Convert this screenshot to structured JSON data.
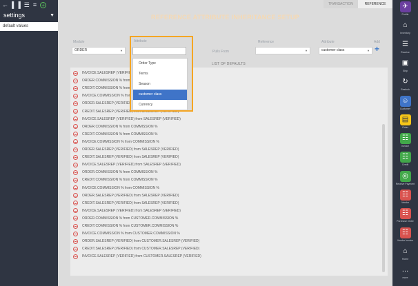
{
  "left_sidebar": {
    "header": "settings",
    "items": [
      "default values"
    ]
  },
  "tabs": [
    {
      "label": "TRANSACTION",
      "active": false
    },
    {
      "label": "REFERENCE",
      "active": true
    }
  ],
  "page_title": "REFERENCE ATTRIBUTE INHERITANCE SETUP",
  "form": {
    "module_label": "Module",
    "module_value": "ORDER",
    "attribute_label": "Attribute",
    "pulls_from_label": "Pulls From",
    "reference_label": "Reference",
    "attribute2_label": "Attribute",
    "attribute2_value": "customer class",
    "add_label": "Add"
  },
  "attribute_options": [
    {
      "label": "Order Type",
      "selected": false
    },
    {
      "label": "Terms",
      "selected": false
    },
    {
      "label": "Season",
      "selected": false
    },
    {
      "label": "customer class",
      "selected": true
    },
    {
      "label": "Currency",
      "selected": false
    }
  ],
  "list_title": "LIST OF DEFAULTS",
  "defaults": [
    "INVOICE.SALESREP (VERIFIED) from SALESREP (VERIFIED)",
    "ORDER.COMMISSION % from COMMISSION %",
    "CREDIT.COMMISSION % from COMMISSION %",
    "INVOICE.COMMISSION % from COMMISSION %",
    "ORDER.SALESREP (VERIFIED) from SALESREP (VERIFIED)",
    "CREDIT.SALESREP (VERIFIED) from SALESREP (VERIFIED)",
    "INVOICE.SALESREP (VERIFIED) from SALESREP (VERIFIED)",
    "ORDER.COMMISSION % from COMMISSION %",
    "CREDIT.COMMISSION % from COMMISSION %",
    "INVOICE.COMMISSION % from COMMISSION %",
    "ORDER.SALESREP (VERIFIED) from SALESREP (VERIFIED)",
    "CREDIT.SALESREP (VERIFIED) from SALESREP (VERIFIED)",
    "INVOICE.SALESREP (VERIFIED) from SALESREP (VERIFIED)",
    "ORDER.COMMISSION % from COMMISSION %",
    "CREDIT.COMMISSION % from COMMISSION %",
    "INVOICE.COMMISSION % from COMMISSION %",
    "ORDER.SALESREP (VERIFIED) from SALESREP (VERIFIED)",
    "CREDIT.SALESREP (VERIFIED) from SALESREP (VERIFIED)",
    "INVOICE.SALESREP (VERIFIED) from SALESREP (VERIFIED)",
    "ORDER.COMMISSION % from CUSTOMER.COMMISSION %",
    "CREDIT.COMMISSION % from CUSTOMER.COMMISSION %",
    "INVOICE.COMMISSION % from CUSTOMER.COMMISSION %",
    "ORDER.SALESREP (VERIFIED) from CUSTOMER.SALESREP (VERIFIED)",
    "CREDIT.SALESREP (VERIFIED) from CUSTOMER.SALESREP (VERIFIED)",
    "INVOICE.SALESREP (VERIFIED) from CUSTOMER.SALESREP (VERIFIED)"
  ],
  "right_sidebar": [
    {
      "label": "Profile",
      "icon": "rocket-icon",
      "style": "purple"
    },
    {
      "label": "Inventory",
      "icon": "hanger-icon",
      "style": ""
    },
    {
      "label": "Receive",
      "icon": "clipboard-icon",
      "style": ""
    },
    {
      "label": "Ship",
      "icon": "truck-icon",
      "style": ""
    },
    {
      "label": "Restock",
      "icon": "refresh-icon",
      "style": ""
    },
    {
      "label": "Customer",
      "icon": "users-icon",
      "style": "active"
    },
    {
      "label": "Order",
      "icon": "box-icon",
      "style": "yellow"
    },
    {
      "label": "Invoice",
      "icon": "invoice-icon",
      "style": "green"
    },
    {
      "label": "Credit",
      "icon": "credit-icon",
      "style": "green"
    },
    {
      "label": "Receive Payment",
      "icon": "money-icon",
      "style": "green"
    },
    {
      "label": "Vendor",
      "icon": "vendor-icon",
      "style": "red"
    },
    {
      "label": "Purchase Order",
      "icon": "po-icon",
      "style": "red"
    },
    {
      "label": "Vendor Invoice",
      "icon": "vendor-invoice-icon",
      "style": "red"
    },
    {
      "label": "Home",
      "icon": "home-icon",
      "style": ""
    },
    {
      "label": "more",
      "icon": "more-icon",
      "style": ""
    }
  ]
}
